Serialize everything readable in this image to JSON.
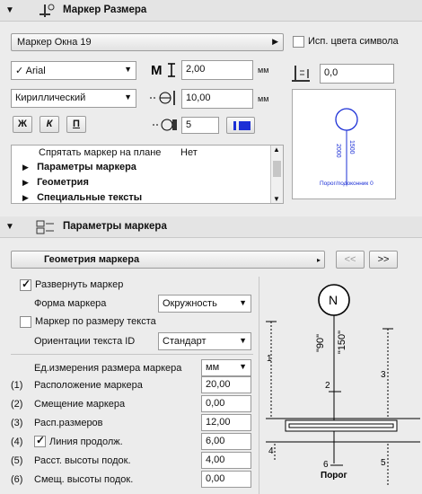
{
  "marker_panel": {
    "title": "Маркер Размера",
    "marker_selector": "Маркер Окна 19",
    "use_symbol_colors": "Исп. цвета символа",
    "font": "Arial",
    "charset": "Кириллический",
    "text_height": "2,00",
    "text_height_unit": "мм",
    "leading": "10,00",
    "leading_unit": "мм",
    "pen": "5",
    "angle": "0,0",
    "style_bold": "Ж",
    "style_italic": "К",
    "style_underline": "П",
    "params_list": [
      {
        "name": "Спрятать маркер на плане",
        "value": "Нет",
        "expandable": false
      },
      {
        "name": "Параметры маркера",
        "value": "",
        "expandable": true
      },
      {
        "name": "Геометрия",
        "value": "",
        "expandable": true
      },
      {
        "name": "Специальные тексты",
        "value": "",
        "expandable": true
      }
    ],
    "preview_text": "Порог/подоконник 0",
    "preview_vals": [
      "2000",
      "1500"
    ]
  },
  "params_panel": {
    "title": "Параметры маркера",
    "geometry_dropdown": "Геометрия маркера",
    "prev_btn": "<<",
    "next_btn": ">>",
    "expand_marker": "Развернуть маркер",
    "marker_shape_label": "Форма маркера",
    "marker_shape": "Окружность",
    "marker_by_text": "Маркер по размеру текста",
    "text_orientation_label": "Ориентации текста ID",
    "text_orientation": "Стандарт",
    "unit_label": "Ед.измерения размера маркера",
    "unit_value": "мм",
    "rows": [
      {
        "num": "(1)",
        "label": "Расположение маркера",
        "value": "20,00"
      },
      {
        "num": "(2)",
        "label": "Смещение маркера",
        "value": "0,00"
      },
      {
        "num": "(3)",
        "label": "Расп.размеров",
        "value": "12,00"
      },
      {
        "num": "(4)",
        "label": "Линия продолж.",
        "value": "6,00"
      },
      {
        "num": "(5)",
        "label": "Расст. высоты подок.",
        "value": "4,00"
      },
      {
        "num": "(6)",
        "label": "Смещ. высоты подок.",
        "value": "0,00"
      }
    ],
    "diagram": {
      "symbol": "N",
      "val1": "\"90\"",
      "val2": "\"150\"",
      "caption": "Порог",
      "dims": [
        "1",
        "2",
        "3",
        "4",
        "5",
        "6"
      ]
    }
  }
}
